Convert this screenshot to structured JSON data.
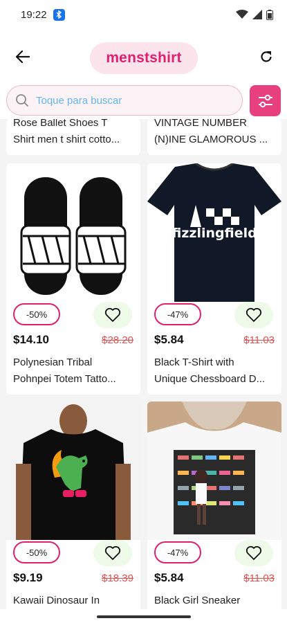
{
  "status_bar": {
    "time": "19:22"
  },
  "app_bar": {
    "title": "menstshirt"
  },
  "search": {
    "placeholder": "Toque para buscar"
  },
  "colors": {
    "accent": "#e0206e",
    "filter_bg": "#e8407e",
    "old_price": "#e05252",
    "heart_bg": "#eefbe9"
  },
  "top_row": [
    {
      "name_lines": [
        "Rose Ballet Shoes T",
        "Shirt men t shirt cotto..."
      ]
    },
    {
      "name_lines": [
        "VINTAGE NUMBER",
        "(N)INE GLAMOROUS ..."
      ]
    }
  ],
  "products": [
    {
      "discount": "-50%",
      "price": "$14.10",
      "old_price": "$28.20",
      "name_lines": [
        "Polynesian Tribal",
        "Pohnpei Totem Tatto..."
      ],
      "image": "slides-sandals"
    },
    {
      "discount": "-47%",
      "price": "$5.84",
      "old_price": "$11.03",
      "name_lines": [
        "Black T-Shirt with",
        "Unique Chessboard D..."
      ],
      "image": "black-tshirt-chess",
      "image_text": "fizzlingfield"
    },
    {
      "discount": "-50%",
      "price": "$9.19",
      "old_price": "$18.39",
      "name_lines": [
        "Kawaii Dinosaur In"
      ],
      "image": "black-tshirt-dino"
    },
    {
      "discount": "-47%",
      "price": "$5.84",
      "old_price": "$11.03",
      "name_lines": [
        "Black Girl Sneaker"
      ],
      "image": "white-tshirt-sneaker"
    }
  ]
}
